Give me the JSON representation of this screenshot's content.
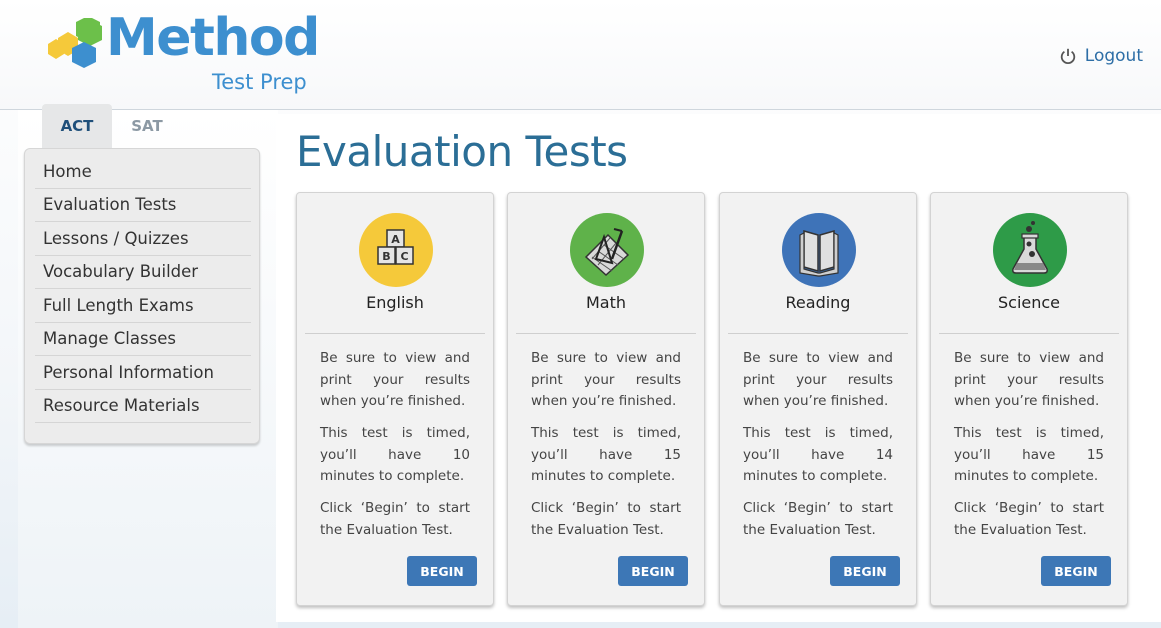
{
  "header": {
    "logo_word": "Method",
    "logo_sub": "Test Prep",
    "logout_label": "Logout"
  },
  "tabs": [
    {
      "label": "ACT",
      "active": true
    },
    {
      "label": "SAT",
      "active": false
    }
  ],
  "nav": {
    "items": [
      {
        "label": "Home"
      },
      {
        "label": "Evaluation Tests"
      },
      {
        "label": "Lessons / Quizzes"
      },
      {
        "label": "Vocabulary Builder"
      },
      {
        "label": "Full Length Exams"
      },
      {
        "label": "Manage Classes"
      },
      {
        "label": "Personal Information"
      },
      {
        "label": "Resource Materials"
      }
    ]
  },
  "page": {
    "title": "Evaluation Tests"
  },
  "cards": [
    {
      "subject": "English",
      "icon": "abc-blocks-icon",
      "color": "#f5c93a",
      "text1": "Be sure to view and print your results when you’re finished.",
      "text2": "This test is timed, you’ll have 10 minutes to complete.",
      "text3": "Click ‘Begin’ to start the Evaluation Test.",
      "button": "BEGIN"
    },
    {
      "subject": "Math",
      "icon": "geometry-tools-icon",
      "color": "#5fb24a",
      "text1": "Be sure to view and print your results when you’re finished.",
      "text2": "This test is timed, you’ll have 15 minutes to complete.",
      "text3": "Click ‘Begin’ to start the Evaluation Test.",
      "button": "BEGIN"
    },
    {
      "subject": "Reading",
      "icon": "open-book-icon",
      "color": "#3e73b8",
      "text1": "Be sure to view and print your results when you’re finished.",
      "text2": "This test is timed, you’ll have 14 minutes to complete.",
      "text3": "Click ‘Begin’ to start the Evaluation Test.",
      "button": "BEGIN"
    },
    {
      "subject": "Science",
      "icon": "flask-icon",
      "color": "#2e9b48",
      "text1": "Be sure to view and print your results when you’re finished.",
      "text2": "This test is timed, you’ll have 15 minutes to complete.",
      "text3": "Click ‘Begin’ to start the Evaluation Test.",
      "button": "BEGIN"
    }
  ]
}
